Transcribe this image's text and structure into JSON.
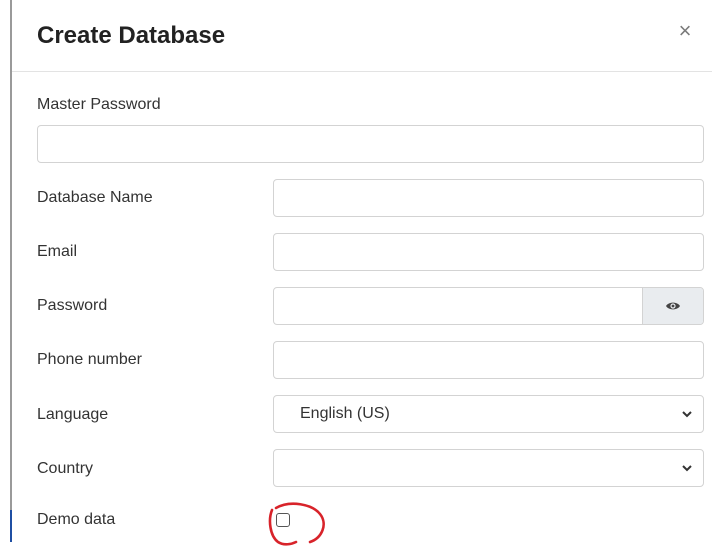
{
  "dialog": {
    "title": "Create Database",
    "close_glyph": "×"
  },
  "form": {
    "master_password": {
      "label": "Master Password",
      "value": ""
    },
    "database_name": {
      "label": "Database Name",
      "value": ""
    },
    "email": {
      "label": "Email",
      "value": ""
    },
    "password": {
      "label": "Password",
      "value": "",
      "toggle_icon": "eye-icon"
    },
    "phone": {
      "label": "Phone number",
      "value": ""
    },
    "language": {
      "label": "Language",
      "selected": "English (US)"
    },
    "country": {
      "label": "Country",
      "selected": ""
    },
    "demo_data": {
      "label": "Demo data",
      "checked": false
    }
  },
  "annotation": {
    "color": "#d8232a"
  }
}
